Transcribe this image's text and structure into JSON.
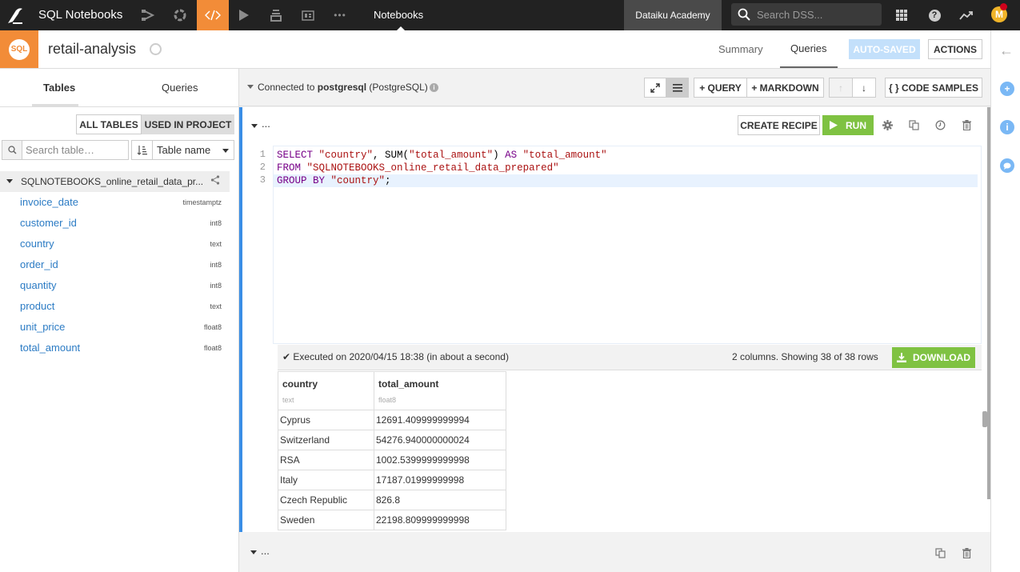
{
  "topnav": {
    "app_title": "SQL Notebooks",
    "section": "Notebooks",
    "workspace": "Dataiku Academy",
    "search_placeholder": "Search DSS...",
    "avatar_initial": "M",
    "nav_icons": [
      "flow-icon",
      "datasets-icon",
      "code-icon",
      "run-icon",
      "deploy-icon",
      "dashboard-icon",
      "more-icon"
    ],
    "accent_color": "#f28c38"
  },
  "header": {
    "badge": "SQL",
    "title": "retail-analysis",
    "tabs": [
      {
        "label": "Summary",
        "active": false
      },
      {
        "label": "Queries",
        "active": true
      }
    ],
    "autosaved_label": "AUTO-SAVED",
    "actions_label": "ACTIONS"
  },
  "left": {
    "tabs": [
      {
        "label": "Tables",
        "active": true
      },
      {
        "label": "Queries",
        "active": false
      }
    ],
    "filter_all": "ALL TABLES",
    "filter_used": "USED IN PROJECT",
    "search_placeholder": "Search table…",
    "sort_value": "Table name",
    "table_name": "SQLNOTEBOOKS_online_retail_data_pr...",
    "columns": [
      {
        "name": "invoice_date",
        "type": "timestamptz"
      },
      {
        "name": "customer_id",
        "type": "int8"
      },
      {
        "name": "country",
        "type": "text"
      },
      {
        "name": "order_id",
        "type": "int8"
      },
      {
        "name": "quantity",
        "type": "int8"
      },
      {
        "name": "product",
        "type": "text"
      },
      {
        "name": "unit_price",
        "type": "float8"
      },
      {
        "name": "total_amount",
        "type": "float8"
      }
    ]
  },
  "toolbar": {
    "connected_prefix": "Connected to",
    "connection": "postgresql",
    "connection_type": "(PostgreSQL)",
    "add_query": "+ QUERY",
    "add_markdown": "+ MARKDOWN",
    "code_samples": "{ }  CODE SAMPLES"
  },
  "cell1": {
    "title": "...",
    "create_recipe": "CREATE RECIPE",
    "run": "RUN",
    "code": [
      {
        "n": "1",
        "tokens": [
          [
            "kw",
            "SELECT"
          ],
          [
            "fn",
            " "
          ],
          [
            "str",
            "\"country\""
          ],
          [
            "fn",
            ", SUM("
          ],
          [
            "str",
            "\"total_amount\""
          ],
          [
            "fn",
            ") "
          ],
          [
            "kw",
            "AS"
          ],
          [
            "fn",
            " "
          ],
          [
            "str",
            "\"total_amount\""
          ]
        ]
      },
      {
        "n": "2",
        "tokens": [
          [
            "kw",
            "FROM"
          ],
          [
            "fn",
            " "
          ],
          [
            "str",
            "\"SQLNOTEBOOKS_online_retail_data_prepared\""
          ]
        ]
      },
      {
        "n": "3",
        "tokens": [
          [
            "kw",
            "GROUP BY"
          ],
          [
            "fn",
            " "
          ],
          [
            "str",
            "\"country\""
          ],
          [
            "fn",
            ";"
          ]
        ]
      }
    ],
    "executed": "Executed on 2020/04/15 18:38 (in about a second)",
    "rows_info": "2 columns. Showing 38 of 38 rows",
    "download": "DOWNLOAD",
    "result_columns": [
      {
        "name": "country",
        "type": "text"
      },
      {
        "name": "total_amount",
        "type": "float8"
      }
    ],
    "result_rows": [
      [
        "Cyprus",
        "12691.409999999994"
      ],
      [
        "Switzerland",
        "54276.940000000024"
      ],
      [
        "RSA",
        "1002.5399999999998"
      ],
      [
        "Italy",
        "17187.01999999998"
      ],
      [
        "Czech Republic",
        "826.8"
      ],
      [
        "Sweden",
        "22198.809999999998"
      ]
    ]
  },
  "cell2": {
    "title": "..."
  },
  "colors": {
    "run_green": "#7fc242",
    "link_blue": "#2b7bc4",
    "active_cell_border": "#3a8ee6"
  }
}
